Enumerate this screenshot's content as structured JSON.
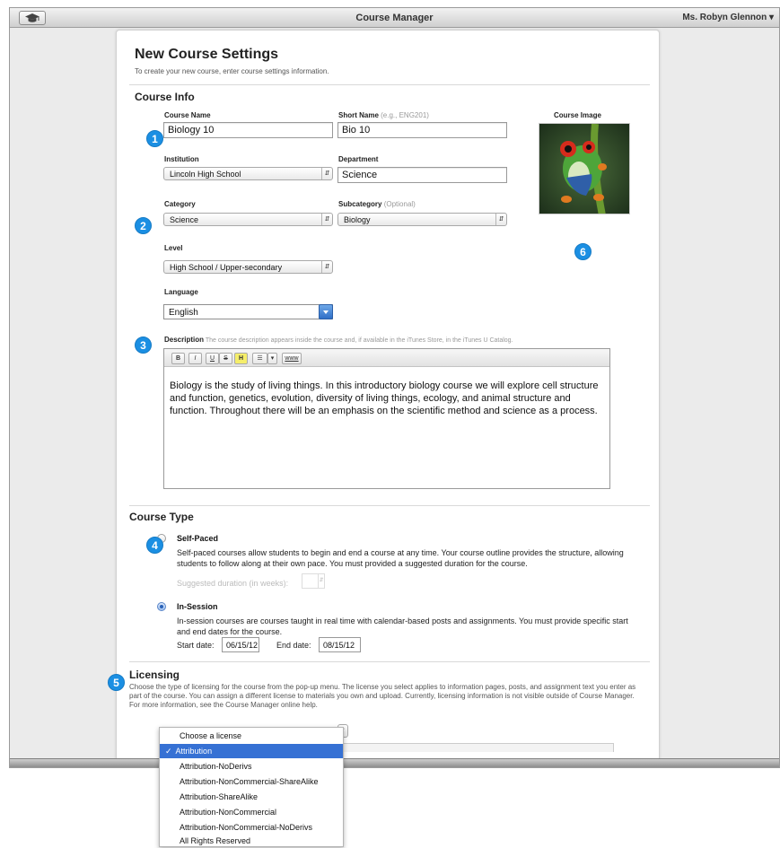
{
  "app": {
    "title": "Course Manager",
    "user_menu": "Ms. Robyn Glennon ▾"
  },
  "page": {
    "title": "New Course Settings",
    "subtitle": "To create your new course, enter course settings information."
  },
  "course_info": {
    "heading": "Course Info",
    "course_name": {
      "label": "Course Name",
      "value": "Biology 10"
    },
    "short_name": {
      "label": "Short Name",
      "hint": "(e.g., ENG201)",
      "value": "Bio 10"
    },
    "course_image_label": "Course Image",
    "institution": {
      "label": "Institution",
      "value": "Lincoln High School"
    },
    "department": {
      "label": "Department",
      "value": "Science"
    },
    "category": {
      "label": "Category",
      "value": "Science"
    },
    "subcategory": {
      "label": "Subcategory",
      "hint": "(Optional)",
      "value": "Biology"
    },
    "level": {
      "label": "Level",
      "value": "High School / Upper-secondary"
    },
    "language": {
      "label": "Language",
      "value": "English"
    },
    "description": {
      "label": "Description",
      "hint": "The course description appears inside the course and, if available in the iTunes Store, in the iTunes U Catalog.",
      "text": "Biology is the study of living things. In this introductory biology course we will explore cell structure and function, genetics, evolution, diversity of living things, ecology, and animal structure and function. Throughout there will be an emphasis on the scientific method and science as a process."
    },
    "toolbar": {
      "bold": "B",
      "italic": "I",
      "underline": "U",
      "strike": "S",
      "highlight": "H",
      "list": "☰",
      "list_menu": "▾",
      "link": "www"
    }
  },
  "course_type": {
    "heading": "Course Type",
    "self_paced": {
      "title": "Self-Paced",
      "text": "Self-paced courses allow students to begin and end a course at any time. Your course outline provides the structure, allowing students to follow along at their own pace. You must provided a suggested duration for the course.",
      "duration_label": "Suggested duration (in weeks):",
      "selected": false
    },
    "in_session": {
      "title": "In-Session",
      "text": "In-session courses are courses taught in real time with calendar-based posts and assignments. You must provide specific start and end dates for the course.",
      "start_label": "Start date:",
      "start_value": "06/15/12",
      "end_label": "End date:",
      "end_value": "08/15/12",
      "selected": true
    }
  },
  "licensing": {
    "heading": "Licensing",
    "text": "Choose the type of licensing for the course from the pop-up menu. The license you select applies to information pages, posts, and assignment text you enter as part of the course. You can assign a different license to materials you own and upload. Currently, licensing information is not visible outside of Course Manager. For more information, see the Course Manager online help.",
    "options": [
      "Choose a license",
      "Attribution",
      "Attribution-NoDerivs",
      "Attribution-NonCommercial-ShareAlike",
      "Attribution-ShareAlike",
      "Attribution-NonCommercial",
      "Attribution-NonCommercial-NoDerivs",
      "All Rights Reserved"
    ],
    "checkmark": "✓",
    "selected_index": 1
  },
  "callouts": [
    "1",
    "2",
    "3",
    "4",
    "5",
    "6"
  ],
  "colors": {
    "badge": "#1b8fe3",
    "selection": "#3671d4"
  }
}
